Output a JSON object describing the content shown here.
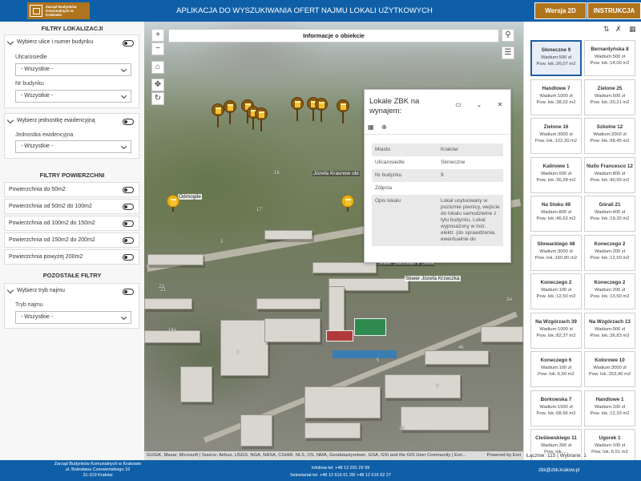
{
  "header": {
    "logo_text": "Zarząd Budynków Komunalnych w Krakowie",
    "title": "APLIKACJA DO WYSZUKIWANIA OFERT NAJMU LOKALI UŻYTKOWYCH",
    "btn_2d": "Wersja 2D",
    "btn_instr": "INSTRUKCJA"
  },
  "sidebar": {
    "loc_title": "FILTRY LOKALIZACJI",
    "street_card_title": "Wybierz ulice i numer budynku",
    "street_label": "Ulica/osiedle",
    "street_value": "- Wszystkie -",
    "bnum_label": "Nr budynku",
    "bnum_value": "- Wszystkie -",
    "unit_card_title": "Wybierz jednostkę ewidencyjną",
    "unit_label": "Jednostka ewidencyjna",
    "unit_value": "- Wszystkie -",
    "area_title": "FILTRY POWIERZCHNI",
    "area_items": [
      "Powierzchnia do 50m2",
      "Powierzchnia od 50m2 do 100m2",
      "Powierzchnia od 100m2 do 150m2",
      "Powierzchnia od 150m2 do 200m2",
      "Powierzchnia powyżej 200m2"
    ],
    "other_title": "POZOSTAŁE FILTRY",
    "mode_card_title": "Wybierz tryb najmu",
    "mode_label": "Tryb najmu",
    "mode_value": "- Wszystkie -"
  },
  "map": {
    "info_bar": "Informacje o obiekcie",
    "zoom_in": "+",
    "zoom_out": "−",
    "labels": [
      "Józefa Krasnow obi",
      "Odmogile",
      "Skwer Józefa Krzeczka",
      "Skwer Stanisław ir Śliwa"
    ],
    "attribution": "GUGiK, Maxar, Microsoft | Source: Airbus, USGS, NGA, NASA, CGIAR, NLS, OS, NMA, Geodatastyrelsen, GSA, GSI and the GIS User Community | Esri...",
    "powered_by": "Powered by Esri"
  },
  "popup": {
    "title": "Lokale ZBK na wynajem:",
    "rows": [
      {
        "k": "Miasto",
        "v": "Kraków"
      },
      {
        "k": "Ulica/osiedle",
        "v": "Słoneczne"
      },
      {
        "k": "Nr budynku",
        "v": "9"
      },
      {
        "k": "Zdjęcia",
        "v": ""
      },
      {
        "k": "Opis lokalu",
        "v": "Lokal usytuowany w poziomie piwnicy, wejście do lokalu samodzielne z tyłu budynku. Lokal wyposażony w inst. elektr. (do sprawdzenia, ewentualnie do"
      }
    ]
  },
  "results": {
    "count_label": "Łącznie: 115 | Wybrane: 1",
    "tiles": [
      {
        "t1": "Słoneczne  9",
        "t2": "Wadium:500 zł",
        "t3": "Pow. lok.:26,07 m2",
        "sel": true
      },
      {
        "t1": "Bernardyńska  8",
        "t2": "Wadium:500 zł",
        "t3": "Pow. lok.:14,00 m2"
      },
      {
        "t1": "Handlowe  7",
        "t2": "Wadium:1000 zł",
        "t3": "Pow. lok.:38,02 m2"
      },
      {
        "t1": "Zielone  25",
        "t2": "Wadium:500 zł",
        "t3": "Pow. lok.:20,21 m2"
      },
      {
        "t1": "Zielone  16",
        "t2": "Wadium:3000 zł",
        "t3": "Pow. lok.:122,30 m2"
      },
      {
        "t1": "Szkolne  12",
        "t2": "Wadium:2000 zł",
        "t3": "Pow. lok.:58,45 m2"
      },
      {
        "t1": "Kalinowe  1",
        "t2": "Wadium:600 zł",
        "t3": "Pow. lok.:36,28 m2"
      },
      {
        "t1": "Nullo Francesco  12",
        "t2": "Wadium:800 zł",
        "t3": "Pow. lok.:40,65 m2"
      },
      {
        "t1": "Na Stoku  49",
        "t2": "Wadium:800 zł",
        "t3": "Pow. lok.:46,62 m2"
      },
      {
        "t1": "Górali  21",
        "t2": "Wadium:400 zł",
        "t3": "Pow. lok.:19,30 m2"
      },
      {
        "t1": "Słowackiego  48",
        "t2": "Wadium:3000 zł",
        "t3": "Pow. lok.:150,80 m2"
      },
      {
        "t1": "Koneczego  2",
        "t2": "Wadium:200 zł",
        "t3": "Pow. lok.:12,50 m2"
      },
      {
        "t1": "Koneczego  2",
        "t2": "Wadium:100 zł",
        "t3": "Pow. lok.:12,50 m2"
      },
      {
        "t1": "Koneczego  2",
        "t2": "Wadium:200 zł",
        "t3": "Pow. lok.:13,50 m2"
      },
      {
        "t1": "Na Wzgórzach  39",
        "t2": "Wadium:1000 zł",
        "t3": "Pow. lok.:82,37 m2"
      },
      {
        "t1": "Na Wzgórzach  13",
        "t2": "Wadium:900 zł",
        "t3": "Pow. lok.:36,83 m2"
      },
      {
        "t1": "Koneczego  6",
        "t2": "Wadium:100 zł",
        "t3": "Pow. lok.:5,50 m2"
      },
      {
        "t1": "Kolorowe  10",
        "t2": "Wadium:3000 zł",
        "t3": "Pow. lok.:253,40 m2"
      },
      {
        "t1": "Borkowska  7",
        "t2": "Wadium:1500 zł",
        "t3": "Pow. lok.:68,96 m2"
      },
      {
        "t1": "Handlowe  1",
        "t2": "Wadium:100 zł",
        "t3": "Pow. lok.:12,33 m2"
      },
      {
        "t1": "Cieślewskiego  11",
        "t2": "Wadium:300 zł",
        "t3": "Pow. lok.:..."
      },
      {
        "t1": "Ugorek  1",
        "t2": "Wadium:100 zł",
        "t3": "Pow. lok.:6,51 m2"
      }
    ]
  },
  "footer": {
    "org1": "Zarząd Budynków Komunalnych w Krakowie",
    "org2": "ul. Bolesława Czerwieńskiego 16",
    "org3": "31-319 Kraków",
    "phone1": "Infolinia tel. +48 12 291 29 99",
    "phone2": "Sekretariat tel. +48 12 616 61 28/ +48 12 616 62 27",
    "email": "zbk@zbk.krakow.pl"
  }
}
